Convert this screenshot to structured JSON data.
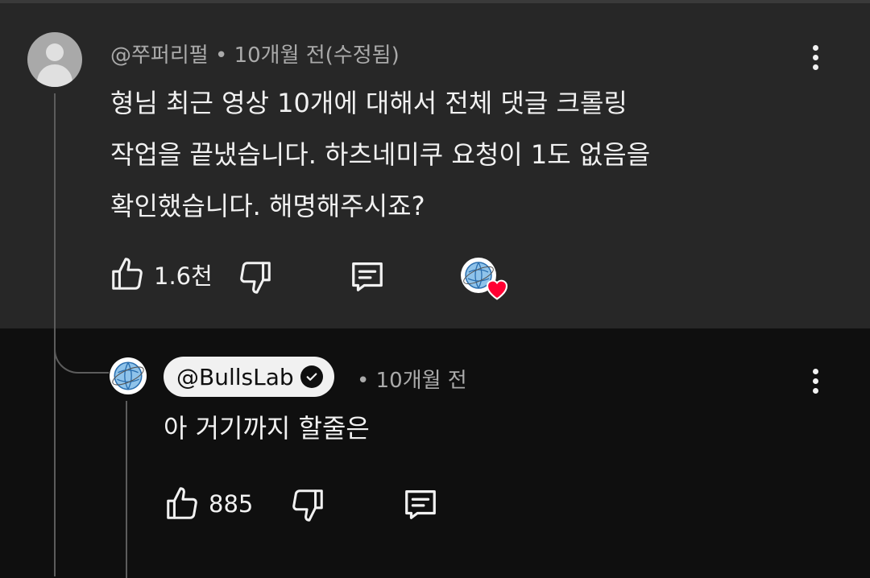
{
  "comment": {
    "author": "@쭈퍼리펄",
    "meta_sep": "•",
    "time": "10개월 전(수정됨)",
    "text_lines": [
      "형님 최근 영상 10개에 대해서 전체 댓글 크롤링",
      "작업을 끝냈습니다. 하츠네미쿠 요청이 1도 없음을",
      "확인했습니다. 해명해주시죠?"
    ],
    "likes": "1.6천",
    "icons": {
      "like": "thumbs-up-icon",
      "dislike": "thumbs-down-icon",
      "reply": "reply-icon",
      "creator_heart": "heart-icon",
      "menu": "more-vert-icon"
    }
  },
  "reply": {
    "author": "@BullsLab",
    "meta_sep": "•",
    "time": "10개월 전",
    "text": "아 거기까지 할줄은",
    "likes": "885"
  },
  "colors": {
    "comment_bg": "#272727",
    "page_bg": "#0f0f0f",
    "heart": "#ff0033",
    "text": "#f1f1f1",
    "meta": "#aaaaaa"
  }
}
